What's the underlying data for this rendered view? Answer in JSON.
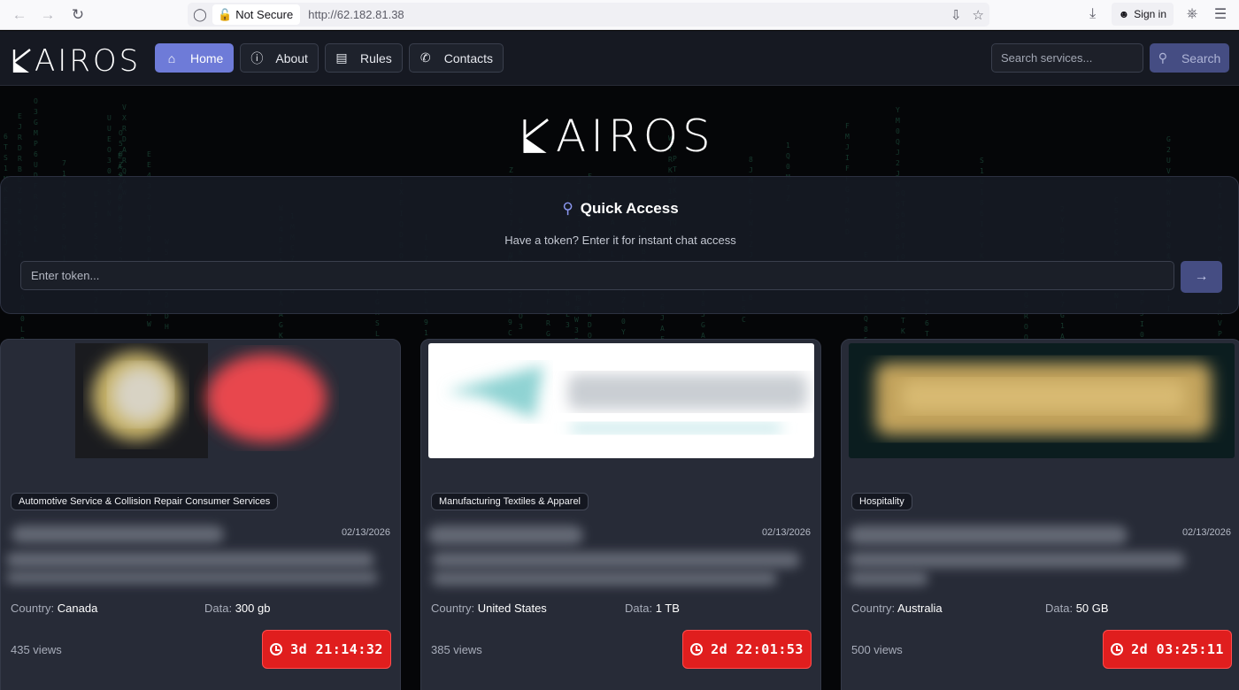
{
  "browser": {
    "not_secure_label": "Not Secure",
    "url": "http://62.182.81.38",
    "sign_in_label": "Sign in"
  },
  "nav": {
    "logo_text": "AIROS",
    "links": [
      {
        "label": "Home",
        "icon": "home-icon",
        "active": true
      },
      {
        "label": "About",
        "icon": "info-icon",
        "active": false
      },
      {
        "label": "Rules",
        "icon": "document-icon",
        "active": false
      },
      {
        "label": "Contacts",
        "icon": "phone-icon",
        "active": false
      }
    ],
    "search_placeholder": "Search services...",
    "search_button": "Search"
  },
  "hero": {
    "logo_text": "AIROS"
  },
  "quick_access": {
    "title": "Quick Access",
    "subtitle": "Have a token? Enter it for instant chat access",
    "token_placeholder": "Enter token..."
  },
  "cards": [
    {
      "category": "Automotive Service & Collision Repair Consumer Services",
      "date": "02/13/2026",
      "country_label": "Country:",
      "country": "Canada",
      "data_label": "Data:",
      "data": "300 gb",
      "views": "435 views",
      "timer": "3d 21:14:32"
    },
    {
      "category": "Manufacturing Textiles & Apparel",
      "date": "02/13/2026",
      "country_label": "Country:",
      "country": "United States",
      "data_label": "Data:",
      "data": "1 TB",
      "views": "385 views",
      "timer": "2d 22:01:53"
    },
    {
      "category": "Hospitality",
      "date": "02/13/2026",
      "country_label": "Country:",
      "country": "Australia",
      "data_label": "Data:",
      "data": "50 GB",
      "views": "500 views",
      "timer": "2d 03:25:11"
    }
  ],
  "colors": {
    "accent": "#6e7bd8",
    "timer_red": "#e01e1e",
    "card_bg": "#272b37"
  }
}
